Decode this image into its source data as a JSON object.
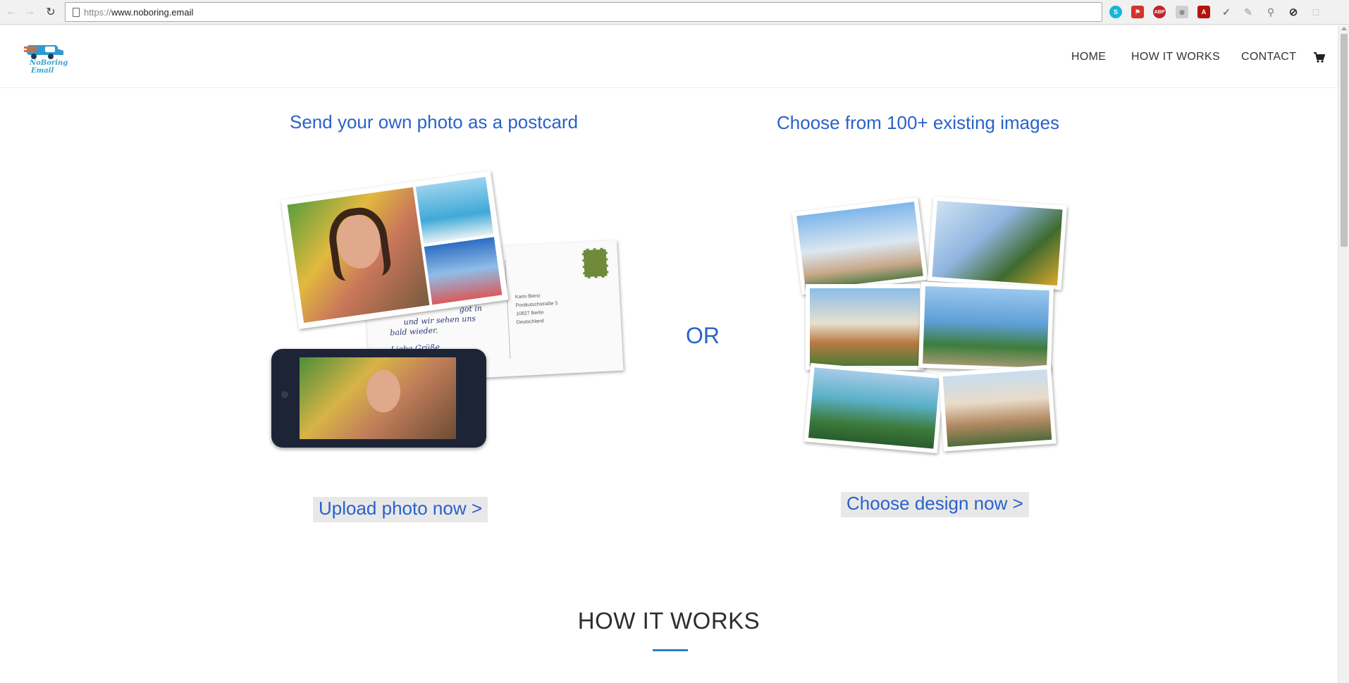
{
  "browser": {
    "url_scheme": "https://",
    "url_host": "www.noboring.email",
    "extensions": [
      "skype-icon",
      "flag-icon",
      "adblock-icon",
      "camera-icon",
      "pdf-icon",
      "feather-icon",
      "brush-icon",
      "search-icon",
      "block-icon",
      "chat-icon"
    ],
    "extension_abp_label": "ABP"
  },
  "header": {
    "logo_line1": "NoBoring",
    "logo_line2": "Email",
    "menu": {
      "home": "HOME",
      "how_it_works": "HOW IT WORKS",
      "contact": "CONTACT"
    }
  },
  "hero": {
    "left_title": "Send your own photo as a postcard",
    "right_title": "Choose from 100+ existing images",
    "or_label": "OR",
    "upload_cta": "Upload photo now >",
    "design_cta": "Choose design now >",
    "postcard_text": {
      "line1": "got in",
      "line2": "und wir sehen uns",
      "line3": "bald wieder.",
      "signoff": "Liebe Grüße",
      "addr1": "Karin Bienz",
      "addr2": "Postkutschstraße 5",
      "addr3": "10827 Berlin",
      "addr4": "Deutschland"
    }
  },
  "section": {
    "how_it_works_title": "HOW IT WORKS"
  },
  "colors": {
    "accent_blue": "#2a62c9",
    "underline_blue": "#2a7fd4",
    "logo_teal": "#3aa3c9"
  }
}
